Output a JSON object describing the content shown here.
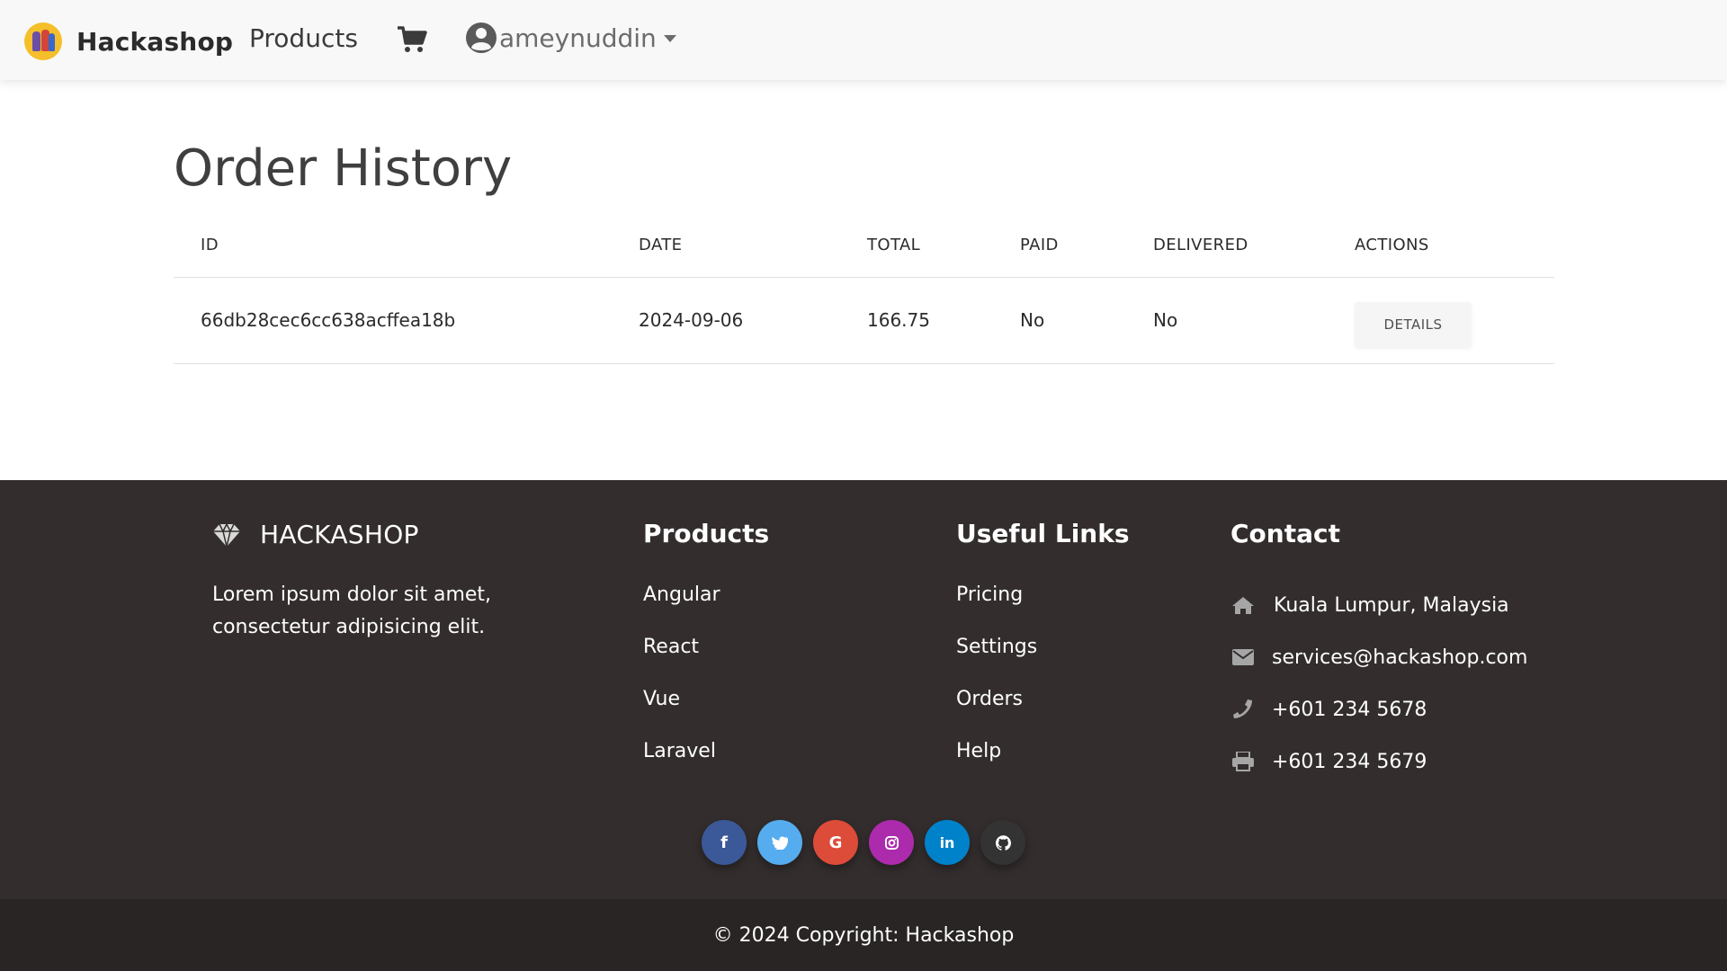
{
  "navbar": {
    "brand_name": "Hackashop",
    "products_label": "Products",
    "cart_icon": "shopping-cart-icon",
    "user_icon": "user-circle-icon",
    "username": "ameynuddin"
  },
  "main": {
    "title": "Order History",
    "table": {
      "headers": [
        "ID",
        "DATE",
        "TOTAL",
        "PAID",
        "DELIVERED",
        "ACTIONS"
      ],
      "rows": [
        {
          "id": "66db28cec6cc638acffea18b",
          "date": "2024-09-06",
          "total": "166.75",
          "paid": "No",
          "delivered": "No",
          "action_label": "DETAILS"
        }
      ]
    }
  },
  "footer": {
    "brand": {
      "icon": "diamond-icon",
      "name": "HACKASHOP",
      "description": "Lorem ipsum dolor sit amet, consectetur adipisicing elit."
    },
    "products": {
      "title": "Products",
      "links": [
        "Angular",
        "React",
        "Vue",
        "Laravel"
      ]
    },
    "useful_links": {
      "title": "Useful Links",
      "links": [
        "Pricing",
        "Settings",
        "Orders",
        "Help"
      ]
    },
    "contact": {
      "title": "Contact",
      "items": [
        {
          "icon": "home-icon",
          "text": "Kuala Lumpur, Malaysia"
        },
        {
          "icon": "envelope-icon",
          "text": "services@hackashop.com"
        },
        {
          "icon": "phone-icon",
          "text": "+601 234 5678"
        },
        {
          "icon": "print-icon",
          "text": "+601 234 5679"
        }
      ]
    },
    "socials": [
      {
        "name": "facebook",
        "glyph": "f",
        "color": "#3b5998"
      },
      {
        "name": "twitter",
        "glyph": "t",
        "color": "#55acee"
      },
      {
        "name": "google",
        "glyph": "G",
        "color": "#dd4b39"
      },
      {
        "name": "instagram",
        "glyph": "◎",
        "color": "#ac2bac"
      },
      {
        "name": "linkedin",
        "glyph": "in",
        "color": "#0082ca"
      },
      {
        "name": "github",
        "glyph": "●",
        "color": "#333333"
      }
    ],
    "copyright": "© 2024 Copyright: Hackashop"
  }
}
